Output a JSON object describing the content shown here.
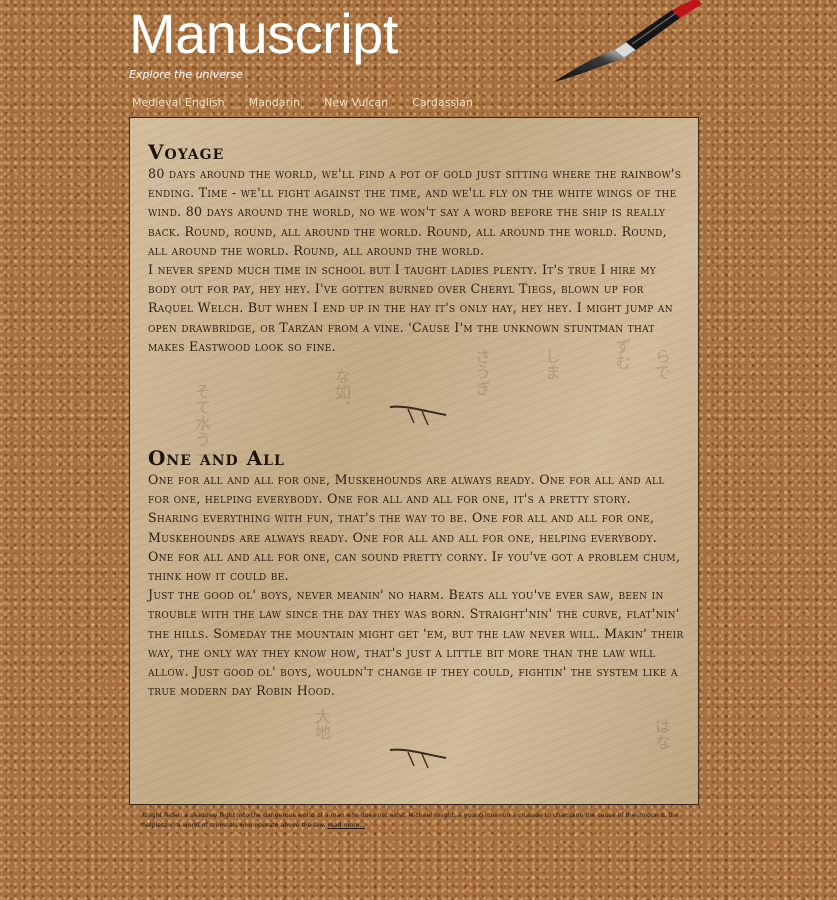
{
  "header": {
    "title": "Manuscript",
    "tagline": "Explore the universe"
  },
  "nav": {
    "items": [
      {
        "label": "Medieval English"
      },
      {
        "label": "Mandarin"
      },
      {
        "label": "New Vulcan"
      },
      {
        "label": "Cardassian"
      }
    ]
  },
  "articles": [
    {
      "heading": "Voyage",
      "paragraphs": [
        "80 days around the world, we'll find a pot of gold just sitting where the rainbow's ending. Time - we'll fight against the time, and we'll fly on the white wings of the wind. 80 days around the world, no we won't say a word before the ship is really back. Round, round, all around the world. Round, all around the world. Round, all around the world. Round, all around the world.",
        "I never spend much time in school but I taught ladies plenty. It's true I hire my body out for pay, hey hey. I've gotten burned over Cheryl Tiegs, blown up for Raquel Welch. But when I end up in the hay it's only hay, hey hey. I might jump an open drawbridge, or Tarzan from a vine. 'Cause I'm the unknown stuntman that makes Eastwood look so fine."
      ]
    },
    {
      "heading": "One and All",
      "paragraphs": [
        "One for all and all for one, Muskehounds are always ready. One for all and all for one, helping everybody. One for all and all for one, it's a pretty story. Sharing everything with fun, that's the way to be. One for all and all for one, Muskehounds are always ready. One for all and all for one, helping everybody. One for all and all for one, can sound pretty corny. If you've got a problem chum, think how it could be.",
        "Just the good ol' boys, never meanin' no harm. Beats all you've ever saw, been in trouble with the law since the day they was born. Straight'nin' the curve, flat'nin' the hills. Someday the mountain might get 'em, but the law never will. Makin' their way, the only way they know how, that's just a little bit more than the law will allow. Just good ol' boys, wouldn't change if they could, fightin' the system like a true modern day Robin Hood."
      ]
    }
  ],
  "footer": {
    "text": "Knight Rider: a shadowy flight into the dangerous world of a man who does not exist. Michael Knight, a young loner on a crusade to champion the cause of the innocent, the helpless in a world of criminals who operate above the law.",
    "link_label": "read more..."
  },
  "colors": {
    "background": "#a8703f",
    "parchment": "#cdb692",
    "ink": "#1e140c",
    "title": "#ffffff",
    "nav": "#f1e6c4"
  }
}
